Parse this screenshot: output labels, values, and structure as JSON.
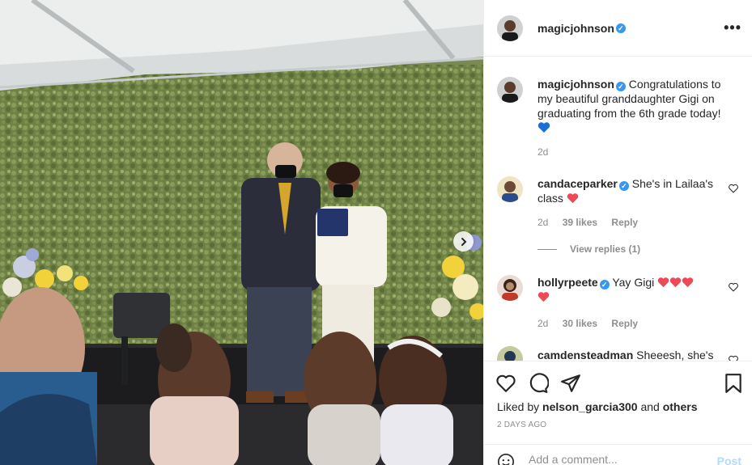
{
  "post": {
    "author": "magicjohnson",
    "more_label": "•••",
    "caption": "Congratulations to my beautiful granddaughter Gigi on graduating from the 6th grade today!",
    "caption_emoji": "blue-heart",
    "caption_age": "2d"
  },
  "comments": [
    {
      "user": "candaceparker",
      "text": "She's in Lailaa's class",
      "age": "2d",
      "likes": "39 likes",
      "reply": "Reply",
      "view_replies": "View replies (1)"
    },
    {
      "user": "hollyrpeete",
      "text": "Yay Gigi",
      "age": "2d",
      "likes": "30 likes",
      "reply": "Reply"
    },
    {
      "user": "camdensteadman",
      "text": "Sheeesh, she's"
    }
  ],
  "actions": {
    "liked_by_prefix": "Liked by",
    "liked_by_user": "nelson_garcia300",
    "liked_by_and": "and",
    "liked_by_others": "others",
    "time": "2 DAYS AGO"
  },
  "composer": {
    "placeholder": "Add a comment...",
    "post_label": "Post"
  },
  "icons": [
    "heart-outline-icon",
    "comment-icon",
    "share-icon",
    "bookmark-icon",
    "emoji-icon",
    "chevron-right-icon",
    "verified-icon"
  ],
  "colors": {
    "verified": "#3897f0",
    "heart_red": "#ed4956",
    "heart_blue": "#1a6fd6",
    "muted": "#8e8e8e",
    "post_disabled": "#b3dbff"
  }
}
